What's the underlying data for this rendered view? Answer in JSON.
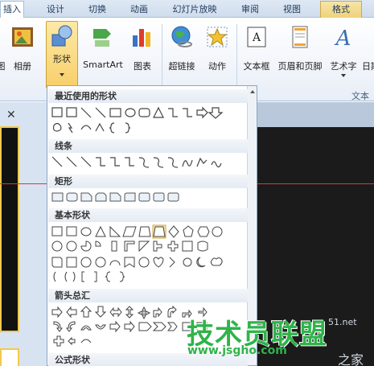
{
  "tabs": {
    "insert": "插入",
    "design": "设计",
    "transitions": "切换",
    "animations": "动画",
    "slideshow": "幻灯片放映",
    "review": "审阅",
    "view": "视图",
    "format": "格式"
  },
  "ribbon": {
    "screenshot_partial": "",
    "album": "相册",
    "shapes": "形状",
    "smartart": "SmartArt",
    "chart": "图表",
    "hyperlink": "超链接",
    "action": "动作",
    "textbox": "文本框",
    "header_footer": "页眉和页脚",
    "wordart": "艺术字",
    "datetime_partial": "日期",
    "text_group": "文本"
  },
  "gallery": {
    "recent": "最近使用的形状",
    "lines": "线条",
    "rectangles": "矩形",
    "basic": "基本形状",
    "arrows": "箭头总汇",
    "equation": "公式形状"
  },
  "watermark": {
    "main": "技术员联盟",
    "url": "www.jsgho.com",
    "partial_url": "51.net",
    "suffix": "之家"
  },
  "colors": {
    "accent_selected": "#f8cf6a",
    "watermark": "#2fb34a"
  }
}
